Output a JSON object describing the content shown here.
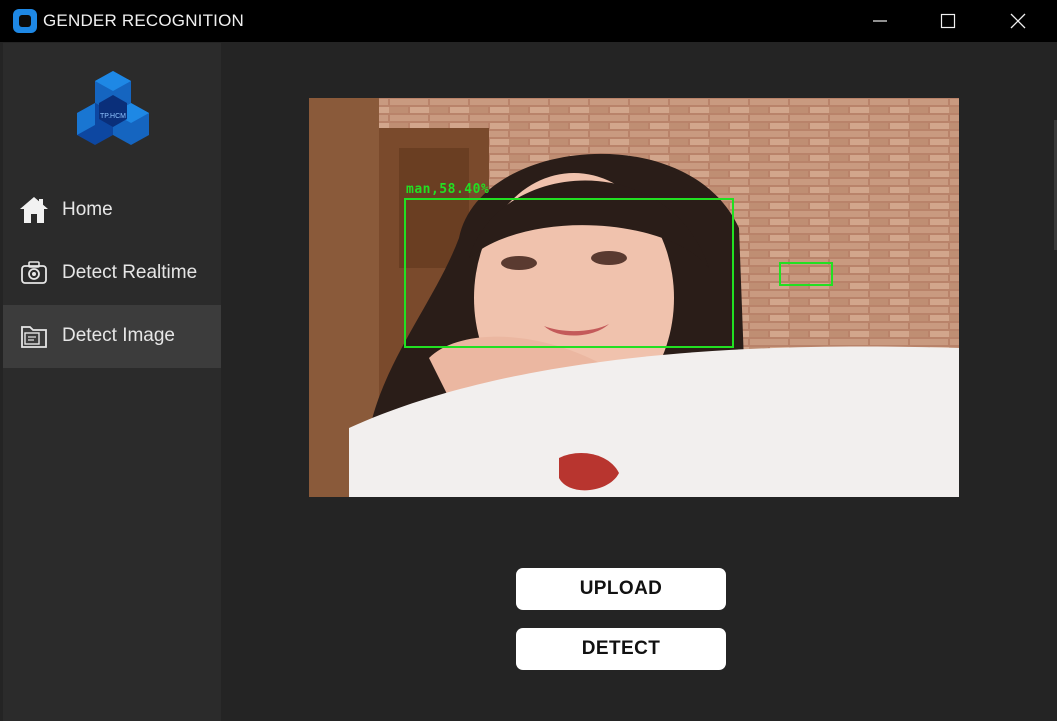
{
  "window": {
    "title": "GENDER RECOGNITION",
    "controls": [
      "minimize-icon",
      "maximize-icon",
      "close-icon"
    ]
  },
  "sidebar": {
    "logo_text": "TP.HCM",
    "items": [
      {
        "label": "Home",
        "icon": "home-icon",
        "selected": false
      },
      {
        "label": "Detect Realtime",
        "icon": "camera-icon",
        "selected": false
      },
      {
        "label": "Detect Image",
        "icon": "folder-icon",
        "selected": true
      }
    ]
  },
  "main": {
    "detection": {
      "label": "man,58.40%"
    },
    "buttons": {
      "upload_label": "UPLOAD",
      "detect_label": "DETECT"
    }
  },
  "colors": {
    "accent": "#1e88e5",
    "detection_box": "#22e022",
    "sidebar_bg": "#2b2b2b",
    "selected_bg": "#3c3c3c",
    "content_bg": "#242424"
  }
}
